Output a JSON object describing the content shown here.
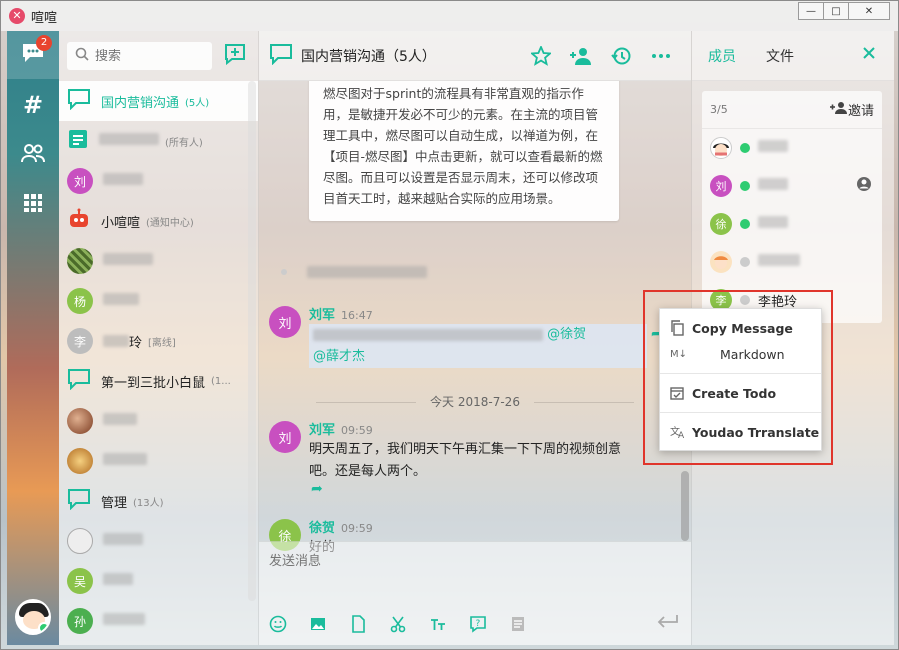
{
  "app": {
    "title": "喧喧"
  },
  "window_controls": {
    "minimize": "—",
    "maximize": "□",
    "close": "✕"
  },
  "rail": {
    "unread_badge": "2"
  },
  "search": {
    "placeholder": "搜索"
  },
  "conversations": [
    {
      "name": "国内营销沟通",
      "sub": "(5人)",
      "avatar_color": "#1abc9c",
      "type": "group",
      "active": true
    },
    {
      "name": "",
      "sub": "(所有人)",
      "avatar_color": "#1abc9c",
      "type": "doc"
    },
    {
      "name": "",
      "sub": "",
      "avatar_color": "#c850c0",
      "avatar_text": "刘",
      "type": "user"
    },
    {
      "name": "小喧喧",
      "sub": "(通知中心)",
      "avatar_color": "#e8442e",
      "type": "robot"
    },
    {
      "name": "",
      "sub": "",
      "avatar_color": "#6a8f3a",
      "type": "photo"
    },
    {
      "name": "",
      "sub": "",
      "avatar_color": "#8bc34a",
      "avatar_text": "杨",
      "type": "user"
    },
    {
      "name": "玲",
      "sub": "[离线]",
      "avatar_color": "#bdbdbd",
      "avatar_text": "李",
      "type": "user"
    },
    {
      "name": "第一到三批小白鼠",
      "sub": "(1...",
      "avatar_color": "#1abc9c",
      "type": "group"
    },
    {
      "name": "",
      "sub": "",
      "avatar_color": "#a0522d",
      "type": "photo"
    },
    {
      "name": "",
      "sub": "",
      "avatar_color": "#d4943a",
      "type": "photo"
    },
    {
      "name": "管理",
      "sub": "(13人)",
      "avatar_color": "#1abc9c",
      "type": "group"
    },
    {
      "name": "",
      "sub": "",
      "avatar_color": "#999999",
      "type": "photo"
    },
    {
      "name": "",
      "sub": "",
      "avatar_color": "#8bc34a",
      "avatar_text": "吴",
      "type": "user"
    },
    {
      "name": "",
      "sub": "",
      "avatar_color": "#4caf50",
      "avatar_text": "孙",
      "type": "user"
    }
  ],
  "chat": {
    "title": "国内营销沟通（5人）",
    "card_text": "燃尽图对于sprint的流程具有非常直观的指示作用，是敏捷开发必不可少的元素。在主流的项目管理工具中，燃尽图可以自动生成，以禅道为例，在【项目-燃尽图】中点击更新，就可以查看最新的燃尽图。而且可以设置是否显示周末，还可以修改项目首天工时，越来越贴合实际的应用场景。",
    "messages": [
      {
        "author": "刘军",
        "avatar": "刘",
        "avatar_color": "#c850c0",
        "time": "16:47",
        "mention1": "@徐贺",
        "mention2": "@薛才杰"
      },
      {
        "author": "刘军",
        "avatar": "刘",
        "avatar_color": "#c850c0",
        "time": "09:59",
        "text1": "明天周五了，我们明天下午再汇集一下下周的视频创意",
        "text2": "吧。还是每人两个。"
      },
      {
        "author": "徐贺",
        "avatar": "徐",
        "avatar_color": "#8bc34a",
        "time": "09:59",
        "text1": "好的"
      }
    ],
    "date_separator": "今天 2018-7-26",
    "composer_placeholder": "发送消息"
  },
  "member_panel": {
    "tabs": [
      "成员",
      "文件"
    ],
    "count": "3/5",
    "invite": "邀请",
    "members": [
      {
        "name": "",
        "avatar_color": "#e57373",
        "avatar_text": "",
        "status_color": "#2ecc71"
      },
      {
        "name": "",
        "avatar_color": "#c850c0",
        "avatar_text": "刘",
        "status_color": "#2ecc71"
      },
      {
        "name": "",
        "avatar_color": "#8bc34a",
        "avatar_text": "徐",
        "status_color": "#2ecc71"
      },
      {
        "name": "",
        "avatar_color": "#f0a050",
        "avatar_text": "",
        "status_color": "#cccccc"
      },
      {
        "name": "李艳玲",
        "avatar_color": "#8bc34a",
        "avatar_text": "李",
        "status_color": "#cccccc"
      }
    ]
  },
  "context_menu": {
    "items": [
      "Copy Message",
      "Markdown",
      "Create Todo",
      "Youdao Trranslate"
    ],
    "markdown_icon_text": "M↓"
  },
  "colors": {
    "accent": "#1abc9c",
    "highlight": "#e0352b"
  }
}
